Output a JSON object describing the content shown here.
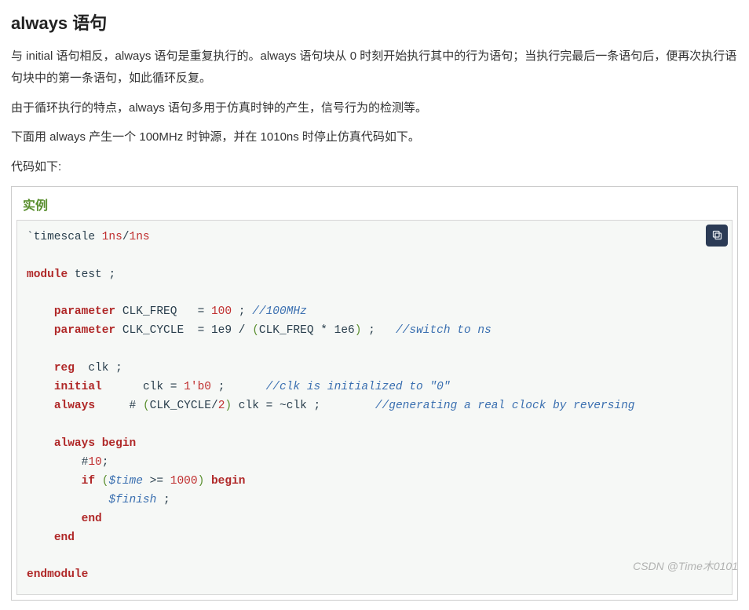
{
  "heading": "always 语句",
  "paragraphs": [
    "与 initial 语句相反，always 语句是重复执行的。always 语句块从 0 时刻开始执行其中的行为语句；当执行完最后一条语句后，便再次执行语句块中的第一条语句，如此循环反复。",
    "由于循环执行的特点，always 语句多用于仿真时钟的产生，信号行为的检测等。",
    "下面用 always 产生一个 100MHz 时钟源，并在 1010ns 时停止仿真代码如下。",
    "代码如下:"
  ],
  "example_label": "实例",
  "code": {
    "l01": {
      "directive": "`timescale",
      "val1": "1ns",
      "slash": "/",
      "val2": "1ns"
    },
    "l03": {
      "kw": "module",
      "name": "test",
      "semi": ";"
    },
    "l05": {
      "kw": "parameter",
      "name": "CLK_FREQ",
      "eq": "=",
      "val": "100",
      "semi": ";",
      "comm": "//100MHz"
    },
    "l06": {
      "kw": "parameter",
      "name": "CLK_CYCLE",
      "eq": "=",
      "v1": "1e9",
      "op": "/",
      "lp": "(",
      "a": "CLK_FREQ",
      "mul": "*",
      "b": "1e6",
      "rp": ")",
      "semi": ";",
      "comm": "//switch to ns"
    },
    "l08": {
      "kw": "reg",
      "name": "clk",
      "semi": ";"
    },
    "l09": {
      "kw": "initial",
      "lhs": "clk",
      "eq": "=",
      "val": "1'b0",
      "semi": ";",
      "comm": "//clk is initialized to \"0\""
    },
    "l10": {
      "kw": "always",
      "hash": "#",
      "lp": "(",
      "a": "CLK_CYCLE",
      "div": "/",
      "b": "2",
      "rp": ")",
      "lhs": "clk",
      "eq": "=",
      "neg": "~",
      "rhs": "clk",
      "semi": ";",
      "comm": "//generating a real clock by reversing"
    },
    "l12": {
      "kw1": "always",
      "kw2": "begin"
    },
    "l13": {
      "hash": "#",
      "val": "10",
      "semi": ";"
    },
    "l14": {
      "kw": "if",
      "lp": "(",
      "sys": "$time",
      "op": ">=",
      "val": "1000",
      "rp": ")",
      "kw2": "begin"
    },
    "l15": {
      "sys": "$finish",
      "semi": ";"
    },
    "l16": {
      "kw": "end"
    },
    "l17": {
      "kw": "end"
    },
    "l19": {
      "kw": "endmodule"
    }
  },
  "watermark": "CSDN @Time木0101"
}
